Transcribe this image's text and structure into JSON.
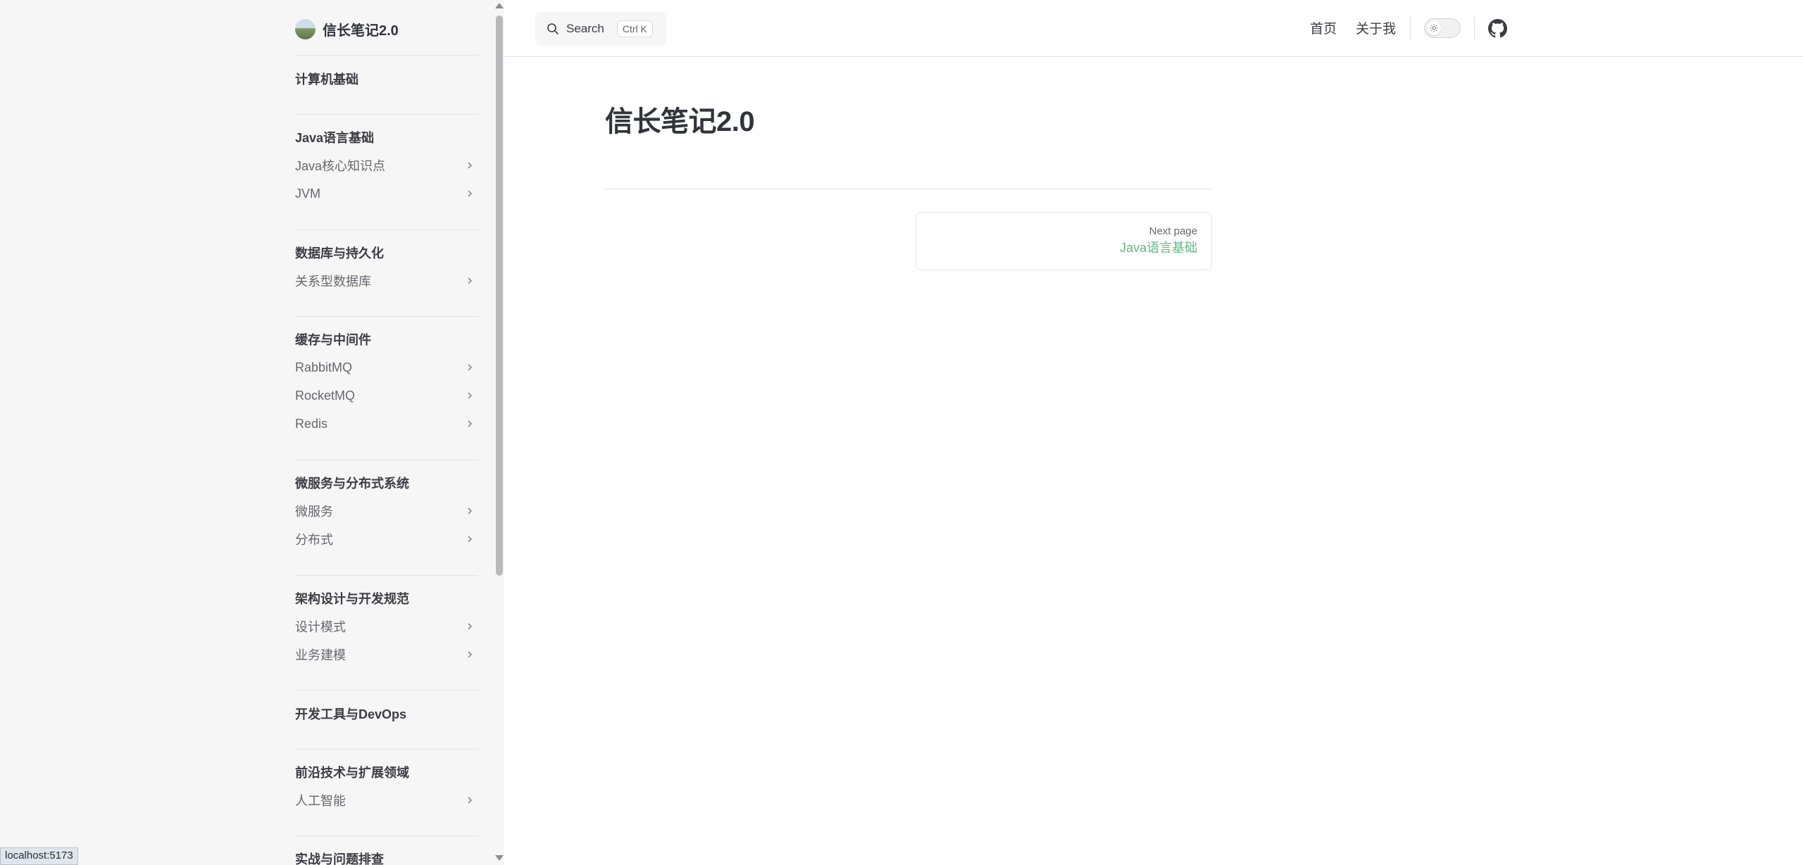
{
  "brand": {
    "title": "信长笔记2.0"
  },
  "sidebar": {
    "groups": [
      {
        "title": "计算机基础",
        "items": []
      },
      {
        "title": "Java语言基础",
        "items": [
          "Java核心知识点",
          "JVM"
        ]
      },
      {
        "title": "数据库与持久化",
        "items": [
          "关系型数据库"
        ]
      },
      {
        "title": "缓存与中间件",
        "items": [
          "RabbitMQ",
          "RocketMQ",
          "Redis"
        ]
      },
      {
        "title": "微服务与分布式系统",
        "items": [
          "微服务",
          "分布式"
        ]
      },
      {
        "title": "架构设计与开发规范",
        "items": [
          "设计模式",
          "业务建模"
        ]
      },
      {
        "title": "开发工具与DevOps",
        "items": []
      },
      {
        "title": "前沿技术与扩展领域",
        "items": [
          "人工智能"
        ]
      },
      {
        "title": "实战与问题排查",
        "items": []
      }
    ]
  },
  "header": {
    "search_label": "Search",
    "search_shortcut": "Ctrl K",
    "nav": [
      "首页",
      "关于我"
    ]
  },
  "main": {
    "title": "信长笔记2.0",
    "next": {
      "desc": "Next page",
      "title": "Java语言基础"
    }
  },
  "status_bar": {
    "url": "localhost:5173"
  },
  "colors": {
    "accent": "#5fb97f",
    "sidebar_bg": "#f6f6f7",
    "text": "#3c3c43"
  },
  "icons": [
    "search-icon",
    "chevron-right-icon",
    "sun-icon",
    "github-icon"
  ]
}
